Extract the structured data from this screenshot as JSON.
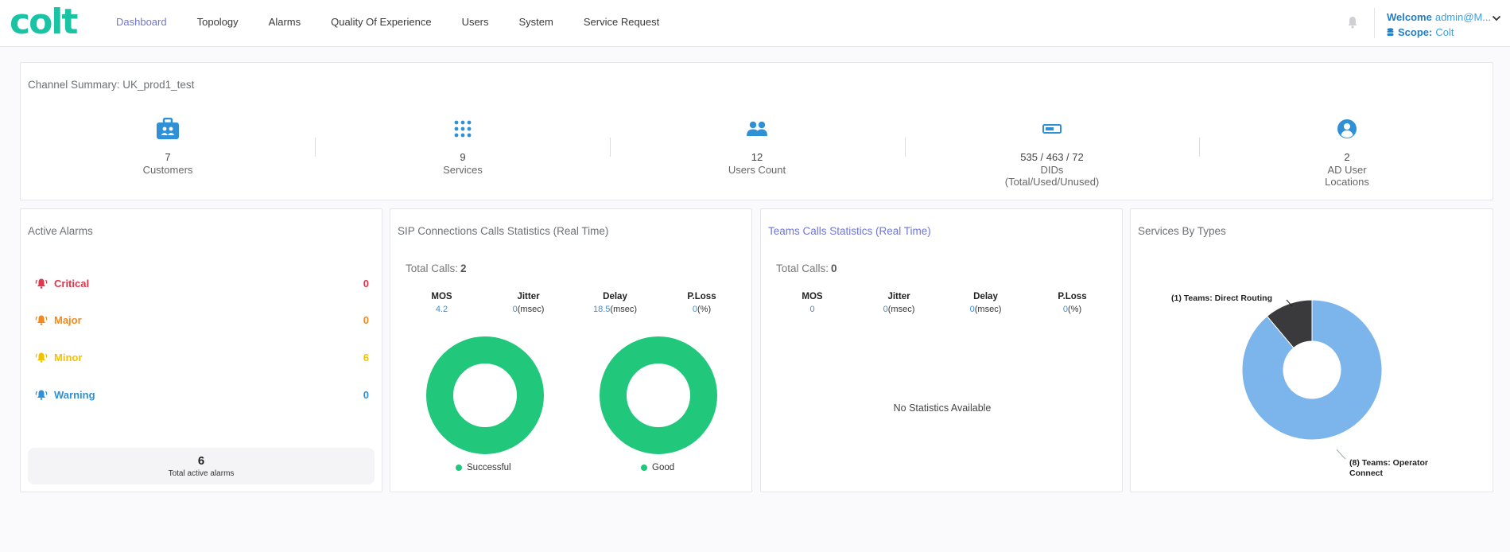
{
  "header": {
    "logo": "colt",
    "nav": [
      "Dashboard",
      "Topology",
      "Alarms",
      "Quality Of Experience",
      "Users",
      "System",
      "Service Request"
    ],
    "welcome_label": "Welcome",
    "welcome_user": "admin@M...",
    "scope_label": "Scope:",
    "scope_value": "Colt"
  },
  "summary": {
    "title": "Channel Summary: UK_prod1_test",
    "stats": [
      {
        "icon": "briefcase-icon",
        "value": "7",
        "label": "Customers",
        "label2": ""
      },
      {
        "icon": "grid-dots-icon",
        "value": "9",
        "label": "Services",
        "label2": ""
      },
      {
        "icon": "users-icon",
        "value": "12",
        "label": "Users Count",
        "label2": ""
      },
      {
        "icon": "sim-card-icon",
        "value": "535 / 463 / 72",
        "label": "DIDs",
        "label2": "(Total/Used/Unused)"
      },
      {
        "icon": "user-location-icon",
        "value": "2",
        "label": "AD User",
        "label2": "Locations"
      }
    ]
  },
  "alarms": {
    "title": "Active Alarms",
    "items": [
      {
        "name": "Critical",
        "count": "0",
        "color": "#e2364a"
      },
      {
        "name": "Major",
        "count": "0",
        "color": "#f08a1c"
      },
      {
        "name": "Minor",
        "count": "6",
        "color": "#f2c200"
      },
      {
        "name": "Warning",
        "count": "0",
        "color": "#2f90d6"
      }
    ],
    "total": "6",
    "total_label": "Total active alarms"
  },
  "sip": {
    "title": "SIP Connections Calls Statistics (Real Time)",
    "total_label": "Total Calls:",
    "total": "2",
    "metrics": [
      {
        "name": "MOS",
        "value": "4.2",
        "unit": ""
      },
      {
        "name": "Jitter",
        "value": "0",
        "unit": "(msec)"
      },
      {
        "name": "Delay",
        "value": "18.5",
        "unit": "(msec)"
      },
      {
        "name": "P.Loss",
        "value": "0",
        "unit": "(%)"
      }
    ],
    "legend_successful": "Successful",
    "legend_good": "Good",
    "donut_color": "#21c77a"
  },
  "teams": {
    "title": "Teams Calls Statistics (Real Time)",
    "total_label": "Total Calls:",
    "total": "0",
    "metrics": [
      {
        "name": "MOS",
        "value": "0",
        "unit": ""
      },
      {
        "name": "Jitter",
        "value": "0",
        "unit": "(msec)"
      },
      {
        "name": "Delay",
        "value": "0",
        "unit": "(msec)"
      },
      {
        "name": "P.Loss",
        "value": "0",
        "unit": "(%)"
      }
    ],
    "no_stats": "No Statistics Available"
  },
  "types": {
    "title": "Services By Types",
    "label_direct": "(1) Teams: Direct Routing",
    "label_operator_1": "(8) Teams: Operator",
    "label_operator_2": "Connect"
  },
  "chart_data": {
    "type": "pie",
    "categories": [
      "Teams: Direct Routing",
      "Teams: Operator Connect"
    ],
    "values": [
      1,
      8
    ],
    "colors": [
      "#3a3a3c",
      "#7cb5ec"
    ],
    "title": "Services By Types"
  }
}
